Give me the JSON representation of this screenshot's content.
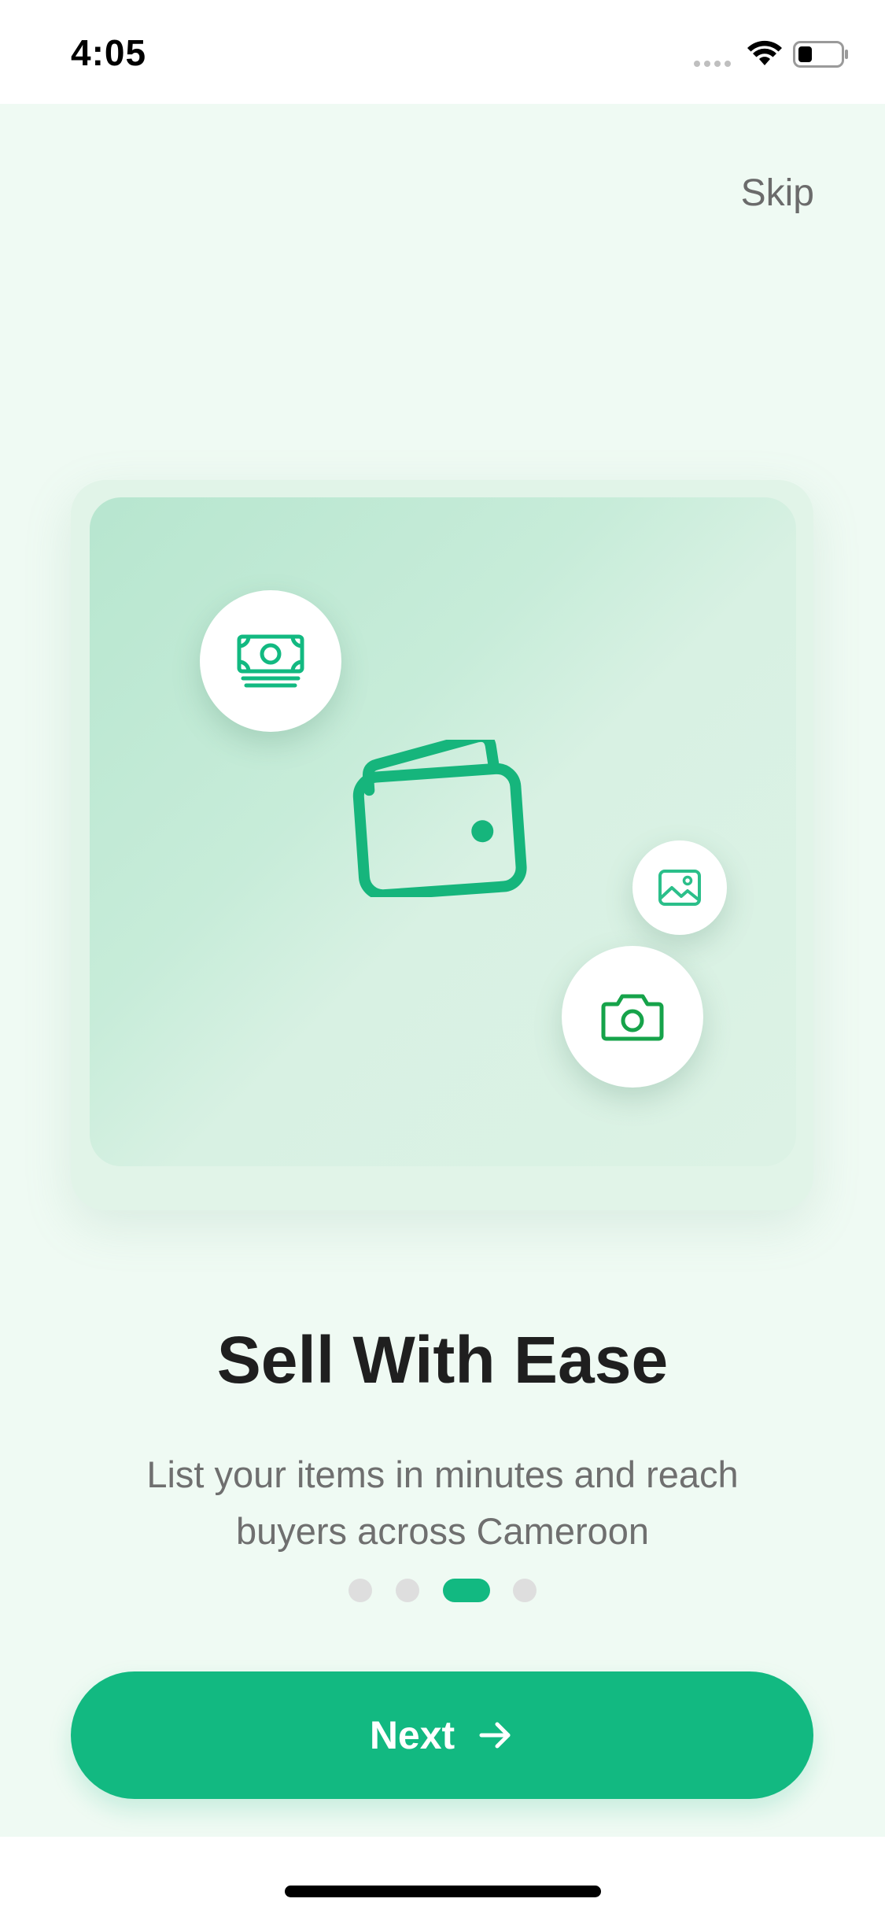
{
  "status_bar": {
    "time": "4:05"
  },
  "onboarding": {
    "skip_label": "Skip",
    "title": "Sell With Ease",
    "subtitle": "List your items in minutes and reach buyers across Cameroon",
    "next_label": "Next",
    "page_count": 4,
    "active_page": 3
  },
  "illustration": {
    "icons": [
      "money-icon",
      "wallet-icon",
      "image-icon",
      "camera-icon"
    ]
  },
  "colors": {
    "accent": "#12B981",
    "background": "#EFFAF3",
    "title": "#1F1F1F",
    "subtitle": "#6F6F6F",
    "dot_inactive": "#DEDEDE"
  }
}
